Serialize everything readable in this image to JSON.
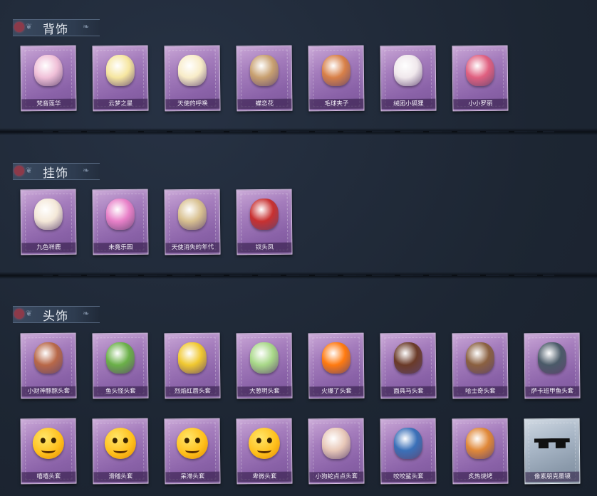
{
  "sections": [
    {
      "title": "背饰",
      "items": [
        {
          "name": "梵音莲华",
          "icon": "lotus-girl-icon",
          "color": "#f0c0d8"
        },
        {
          "name": "云梦之星",
          "icon": "unicorn-cloud-icon",
          "color": "#f6e6a0"
        },
        {
          "name": "天使的呼唤",
          "icon": "angel-icon",
          "color": "#f8ecc8"
        },
        {
          "name": "蝶恋花",
          "icon": "butterfly-birdcage-icon",
          "color": "#c8a070"
        },
        {
          "name": "毛球夹子",
          "icon": "fox-soldier-icon",
          "color": "#d88048"
        },
        {
          "name": "绒团小狐狸",
          "icon": "white-fox-icon",
          "color": "#f0e8ec"
        },
        {
          "name": "小小罗丽",
          "icon": "doll-girl-icon",
          "color": "#e06080"
        }
      ]
    },
    {
      "title": "挂饰",
      "items": [
        {
          "name": "九色祥鹿",
          "icon": "deer-icon",
          "color": "#f4e8d8"
        },
        {
          "name": "未竟乐园",
          "icon": "candy-girl-icon",
          "color": "#e880c8"
        },
        {
          "name": "天使消失的年代",
          "icon": "angel-mirror-icon",
          "color": "#d8c090"
        },
        {
          "name": "钗头凤",
          "icon": "phoenix-crown-icon",
          "color": "#c83030"
        }
      ]
    },
    {
      "title": "头饰",
      "items": [
        {
          "name": "小财神豚豚头套",
          "icon": "pig-head-icon",
          "color": "#b86848"
        },
        {
          "name": "鱼头怪头套",
          "icon": "fish-head-icon",
          "color": "#6ab048"
        },
        {
          "name": "烈焰红唇头套",
          "icon": "pikachu-head-icon",
          "color": "#f0c830"
        },
        {
          "name": "大葱明头套",
          "icon": "scallion-head-icon",
          "color": "#a8d888"
        },
        {
          "name": "火爆了头套",
          "icon": "fire-head-icon",
          "color": "#ff7a10"
        },
        {
          "name": "面具马头套",
          "icon": "horse-head-icon",
          "color": "#6a3a28"
        },
        {
          "name": "哈士奇头套",
          "icon": "husky-head-icon",
          "color": "#8a6040"
        },
        {
          "name": "萨卡班甲鱼头套",
          "icon": "fish-creature-head-icon",
          "color": "#4a5a68"
        }
      ],
      "items_row2": [
        {
          "name": "嘻嘻头套",
          "icon": "grin-emoji-icon",
          "color": "#ffc01c"
        },
        {
          "name": "滑稽头套",
          "icon": "smirk-emoji-icon",
          "color": "#ffc01c"
        },
        {
          "name": "呆滞头套",
          "icon": "dazed-emoji-icon",
          "color": "#ffc01c"
        },
        {
          "name": "卑微头套",
          "icon": "humble-emoji-icon",
          "color": "#ffc01c"
        },
        {
          "name": "小狗蛇点点头套",
          "icon": "dog-snake-head-icon",
          "color": "#e8c8b8"
        },
        {
          "name": "咬咬鲨头套",
          "icon": "shark-head-icon",
          "color": "#3a70b8"
        },
        {
          "name": "炙热烧烤",
          "icon": "bbq-head-icon",
          "color": "#e08838"
        },
        {
          "name": "像素朋克墨镜",
          "icon": "pixel-sunglasses-icon",
          "color": "#111111"
        }
      ]
    }
  ]
}
